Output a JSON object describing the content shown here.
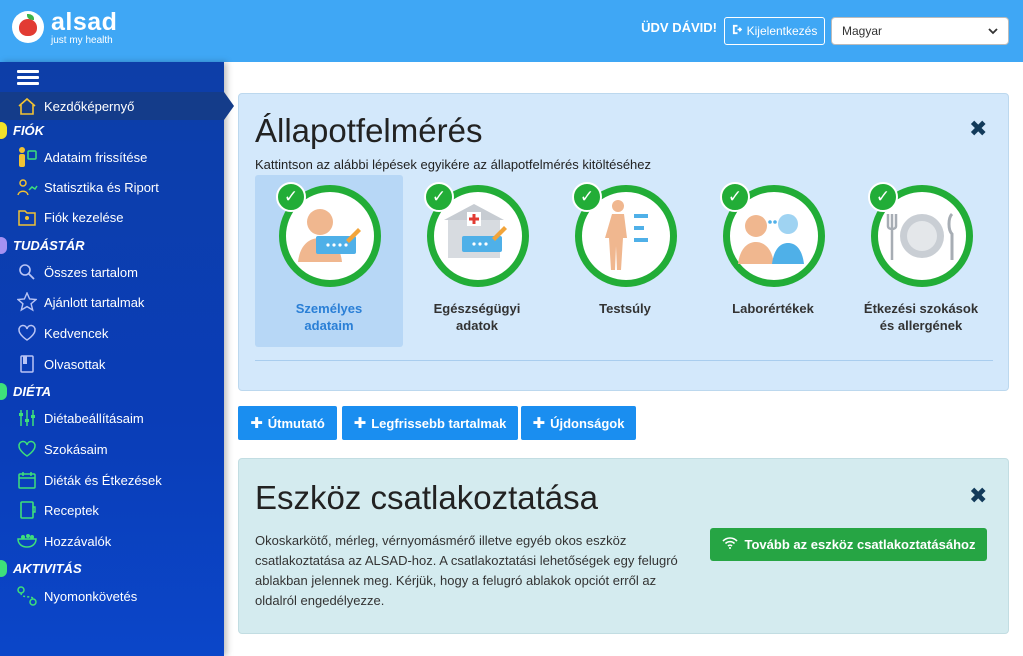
{
  "header": {
    "logo_name": "alsad",
    "logo_tagline": "just my health",
    "greeting": "ÜDV DÁVID!",
    "logout_label": "Kijelentkezés",
    "language_selected": "Magyar"
  },
  "sidebar": {
    "home": "Kezdőképernyő",
    "sections": {
      "account": "FIÓK",
      "knowledge": "TUDÁSTÁR",
      "diet": "DIÉTA",
      "activity": "AKTIVITÁS"
    },
    "items": {
      "update_data": "Adataim frissítése",
      "statistics": "Statisztika és Riport",
      "account_manage": "Fiók kezelése",
      "all_content": "Összes tartalom",
      "recommended": "Ajánlott tartalmak",
      "favorites": "Kedvencek",
      "read": "Olvasottak",
      "diet_settings": "Diétabeállításaim",
      "habits": "Szokásaim",
      "diets_meals": "Diéták és Étkezések",
      "recipes": "Receptek",
      "ingredients": "Hozzávalók",
      "tracking": "Nyomonkövetés"
    }
  },
  "assessment": {
    "title": "Állapotfelmérés",
    "subtitle": "Kattintson az alábbi lépések egyikére az állapotfelmérés kitöltéséhez",
    "steps": [
      {
        "line1": "Személyes",
        "line2": "adataim"
      },
      {
        "line1": "Egészségügyi",
        "line2": "adatok"
      },
      {
        "line1": "Testsúly",
        "line2": ""
      },
      {
        "line1": "Laborértékek",
        "line2": ""
      },
      {
        "line1": "Étkezési szokások",
        "line2": "és allergének"
      }
    ]
  },
  "buttons": {
    "guide": "Útmutató",
    "latest": "Legfrissebb tartalmak",
    "news": "Újdonságok"
  },
  "device": {
    "title": "Eszköz csatlakoztatása",
    "description": "Okoskarkötő, mérleg, vérnyomásmérő illetve egyéb okos eszköz csatlakoztatása az ALSAD-hoz. A csatlakoztatási lehetőségek egy felugró ablakban jelennek meg. Kérjük, hogy a felugró ablakok opciót erről az oldalról engedélyezze.",
    "connect_label": "Tovább az eszköz csatlakoztatásához"
  },
  "colors": {
    "topbar": "#3fa7f5",
    "sidebar": "#0a3db7",
    "accent_green": "#22ad37",
    "button_blue": "#1a8ef0"
  }
}
